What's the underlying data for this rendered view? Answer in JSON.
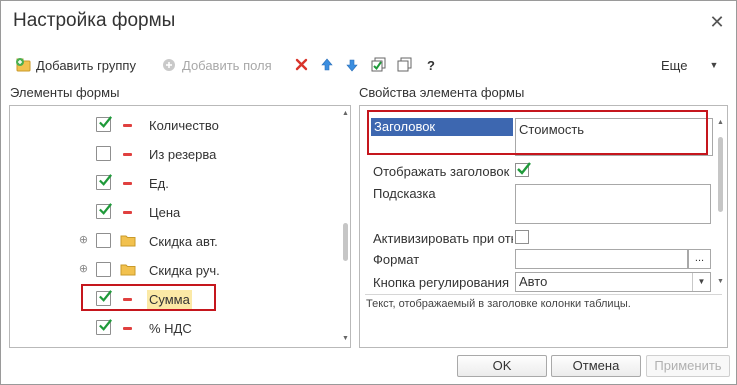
{
  "window": {
    "title": "Настройка формы"
  },
  "toolbar": {
    "add_group_label": "Добавить группу",
    "add_fields_label": "Добавить поля",
    "help_label": "?",
    "more_label": "Еще"
  },
  "left_panel": {
    "title": "Элементы формы",
    "items": [
      {
        "label": "Количество",
        "checked": true,
        "icon": "field-icon",
        "expandable": false,
        "selected": false
      },
      {
        "label": "Из резерва",
        "checked": false,
        "icon": "field-icon",
        "expandable": false,
        "selected": false
      },
      {
        "label": "Ед.",
        "checked": true,
        "icon": "field-icon",
        "expandable": false,
        "selected": false
      },
      {
        "label": "Цена",
        "checked": true,
        "icon": "field-icon",
        "expandable": false,
        "selected": false
      },
      {
        "label": "Скидка авт.",
        "checked": false,
        "icon": "folder-icon",
        "expandable": true,
        "selected": false
      },
      {
        "label": "Скидка руч.",
        "checked": false,
        "icon": "folder-icon",
        "expandable": true,
        "selected": false
      },
      {
        "label": "Сумма",
        "checked": true,
        "icon": "field-icon",
        "expandable": false,
        "selected": true
      },
      {
        "label": "% НДС",
        "checked": true,
        "icon": "field-icon",
        "expandable": false,
        "selected": false
      }
    ]
  },
  "right_panel": {
    "title": "Свойства элемента формы",
    "header_label": "Заголовок",
    "header_value": "Стоимость",
    "show_header_label": "Отображать заголовок",
    "show_header_checked": true,
    "tooltip_label": "Подсказка",
    "tooltip_value": "",
    "activate_label": "Активизировать при открытии",
    "activate_checked": false,
    "format_label": "Формат",
    "format_value": "",
    "format_button": "...",
    "adjust_button_label": "Кнопка регулирования",
    "adjust_button_value": "Авто",
    "hint": "Текст, отображаемый в заголовке колонки таблицы."
  },
  "buttons": {
    "ok": "OK",
    "cancel": "Отмена",
    "apply": "Применить"
  },
  "colors": {
    "accent_red": "#c5161d",
    "selection_blue": "#3d67b0",
    "check_green": "#1f9a3a",
    "selected_row_bg": "#fbe9a6"
  }
}
